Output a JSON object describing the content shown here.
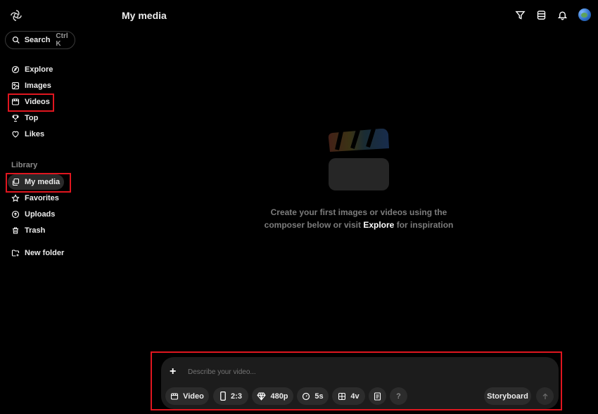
{
  "header": {
    "title": "My media"
  },
  "search": {
    "label": "Search",
    "shortcut": "Ctrl K"
  },
  "nav": {
    "items": [
      {
        "label": "Explore",
        "icon": "compass-icon"
      },
      {
        "label": "Images",
        "icon": "image-icon"
      },
      {
        "label": "Videos",
        "icon": "video-icon"
      },
      {
        "label": "Top",
        "icon": "trophy-icon"
      },
      {
        "label": "Likes",
        "icon": "heart-icon"
      }
    ]
  },
  "library": {
    "label": "Library",
    "items": [
      {
        "label": "My media",
        "icon": "media-icon"
      },
      {
        "label": "Favorites",
        "icon": "star-icon"
      },
      {
        "label": "Uploads",
        "icon": "upload-icon"
      },
      {
        "label": "Trash",
        "icon": "trash-icon"
      }
    ],
    "new_folder": "New folder"
  },
  "empty_state": {
    "line1": "Create your first images or videos using the",
    "line2_prefix": "composer below or visit ",
    "link": "Explore",
    "line2_suffix": " for inspiration"
  },
  "composer": {
    "placeholder": "Describe your video...",
    "mode": "Video",
    "aspect": "2:3",
    "resolution": "480p",
    "duration": "5s",
    "variations": "4v",
    "help": "?",
    "storyboard": "Storyboard"
  },
  "colors": {
    "highlight": "#e0161f",
    "background": "#000000",
    "surface": "#1c1c1c"
  }
}
